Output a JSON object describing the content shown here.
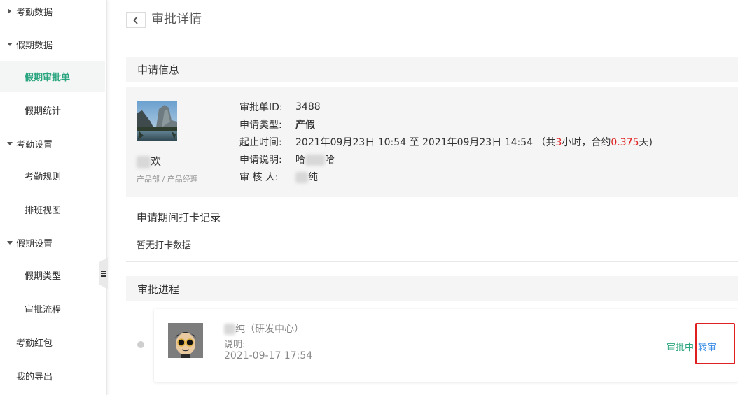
{
  "sidebar": {
    "groups": [
      {
        "label": "考勤数据"
      },
      {
        "label": "假期数据"
      },
      {
        "label": "考勤设置"
      },
      {
        "label": "假期设置"
      }
    ],
    "items": [
      {
        "label": "假期审批单"
      },
      {
        "label": "假期统计"
      },
      {
        "label": "考勤规则"
      },
      {
        "label": "排班视图"
      },
      {
        "label": "假期类型"
      },
      {
        "label": "审批流程"
      }
    ],
    "plain": [
      {
        "label": "考勤红包"
      },
      {
        "label": "我的导出"
      }
    ]
  },
  "header": {
    "title": "审批详情"
  },
  "sections": {
    "apply_info": "申请信息",
    "checkin": "申请期间打卡记录",
    "checkin_empty": "暂无打卡数据",
    "process": "审批进程"
  },
  "applicant": {
    "name_suffix": "欢",
    "dept": "产品部 / 产品经理"
  },
  "info": {
    "id_label": "审批单ID:",
    "id_value": "3488",
    "type_label": "申请类型:",
    "type_value": "产假",
    "time_label": "起止时间:",
    "time_value_pre": "2021年09月23日 10:54 至 2021年09月23日 14:54  （共",
    "time_hours": "3",
    "time_value_mid": "小时，合约",
    "time_days": "0.375",
    "time_value_post": "天)",
    "note_label": "申请说明:",
    "note_prefix": "哈",
    "note_suffix": "哈",
    "reviewer_label": "审  核  人:",
    "reviewer_suffix": "纯"
  },
  "process": {
    "reviewer_suffix": "纯",
    "dept": "（研发中心）",
    "note_label": "说明:",
    "time": "2021-09-17 17:54",
    "status": "审批中",
    "transfer": "转审"
  },
  "colors": {
    "accent": "#2aa57f",
    "link": "#3a8ee6",
    "highlight": "#e02020"
  }
}
